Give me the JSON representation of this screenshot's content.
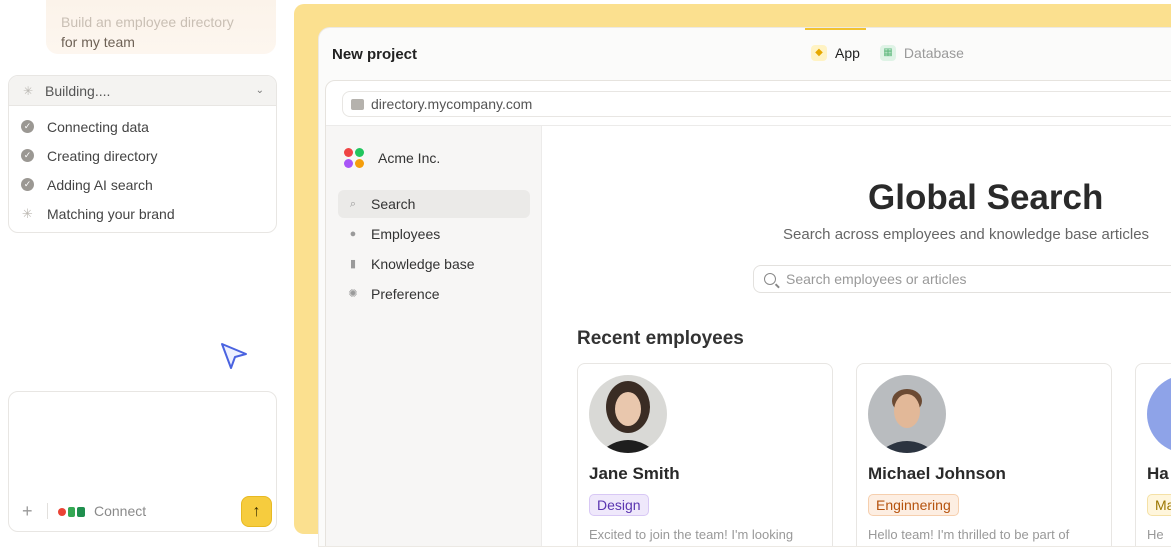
{
  "chat": {
    "prompt_line1": "Build an employee directory",
    "prompt_line2": "for my team",
    "status_title": "Building....",
    "steps": [
      {
        "label": "Connecting data",
        "done": true
      },
      {
        "label": "Creating directory",
        "done": true
      },
      {
        "label": "Adding AI search",
        "done": true
      },
      {
        "label": "Matching your brand",
        "done": false
      }
    ],
    "connect_label": "Connect",
    "send_icon": "arrow-up-icon"
  },
  "window": {
    "title": "New project",
    "tabs": [
      {
        "label": "App",
        "active": true
      },
      {
        "label": "Database",
        "active": false
      }
    ]
  },
  "browser": {
    "url": "directory.mycompany.com"
  },
  "app": {
    "brand": "Acme Inc.",
    "nav": [
      {
        "label": "Search",
        "icon": "search-icon",
        "active": true
      },
      {
        "label": "Employees",
        "icon": "person-icon",
        "active": false
      },
      {
        "label": "Knowledge base",
        "icon": "book-icon",
        "active": false
      },
      {
        "label": "Preference",
        "icon": "gear-icon",
        "active": false
      }
    ],
    "heading": "Global Search",
    "subheading": "Search across employees and knowledge base articles",
    "search_placeholder": "Search employees or articles",
    "recent_title": "Recent employees",
    "employees": [
      {
        "name": "Jane Smith",
        "tag": "Design",
        "tag_bg": "#efe8fb",
        "tag_border": "#d8c8f5",
        "tag_color": "#5a35b0",
        "snippet": "Excited to join the team! I'm looking"
      },
      {
        "name": "Michael Johnson",
        "tag": "Enginnering",
        "tag_bg": "#fdeee2",
        "tag_border": "#f6cfae",
        "tag_color": "#b5520d",
        "snippet": "Hello team! I'm thrilled to be part of"
      },
      {
        "name": "Ha",
        "tag": "Ma",
        "tag_bg": "#fff6dc",
        "tag_border": "#f5e1a6",
        "tag_color": "#9b7600",
        "snippet": "He"
      }
    ]
  },
  "colors": {
    "accent_yellow": "#f6cc3e",
    "frame_yellow": "#fbe08f"
  }
}
